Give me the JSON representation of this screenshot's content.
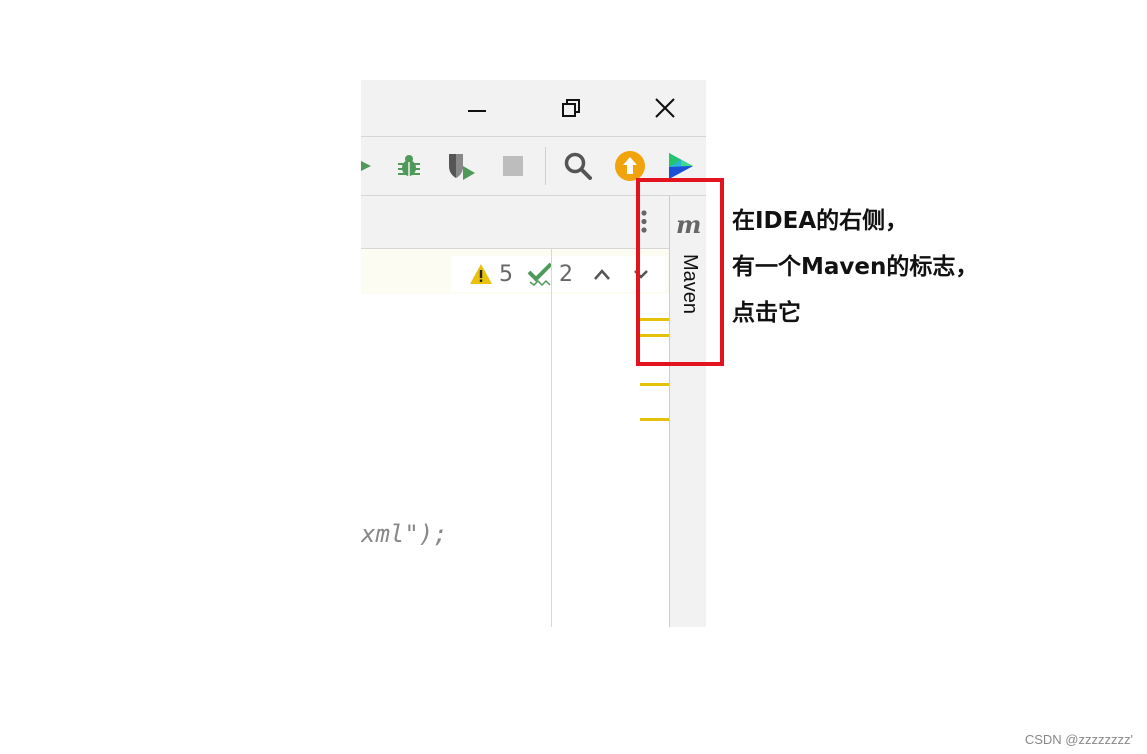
{
  "inspections": {
    "warnings_count": "5",
    "checks_count": "2"
  },
  "editor": {
    "code_fragment": "xml\");"
  },
  "tool_window": {
    "maven_icon_letter": "m",
    "maven_label": "Maven"
  },
  "annotation": {
    "line1": "在IDEA的右侧，",
    "line2": "有一个Maven的标志，",
    "line3": "点击它"
  },
  "watermark": "CSDN @zzzzzzzz'",
  "colors": {
    "highlight_border": "#e3141d",
    "marker_yellow": "#e5c107",
    "debug_green": "#4f9a5a",
    "update_orange": "#f0a30a"
  },
  "icons": [
    "minimize-icon",
    "restore-icon",
    "close-icon",
    "run-icon",
    "debug-icon",
    "coverage-icon",
    "stop-icon",
    "search-icon",
    "update-icon",
    "toolbox-icon",
    "warning-icon",
    "check-icon",
    "chevron-up-icon",
    "chevron-down-icon",
    "kebab-menu-icon",
    "maven-icon"
  ]
}
